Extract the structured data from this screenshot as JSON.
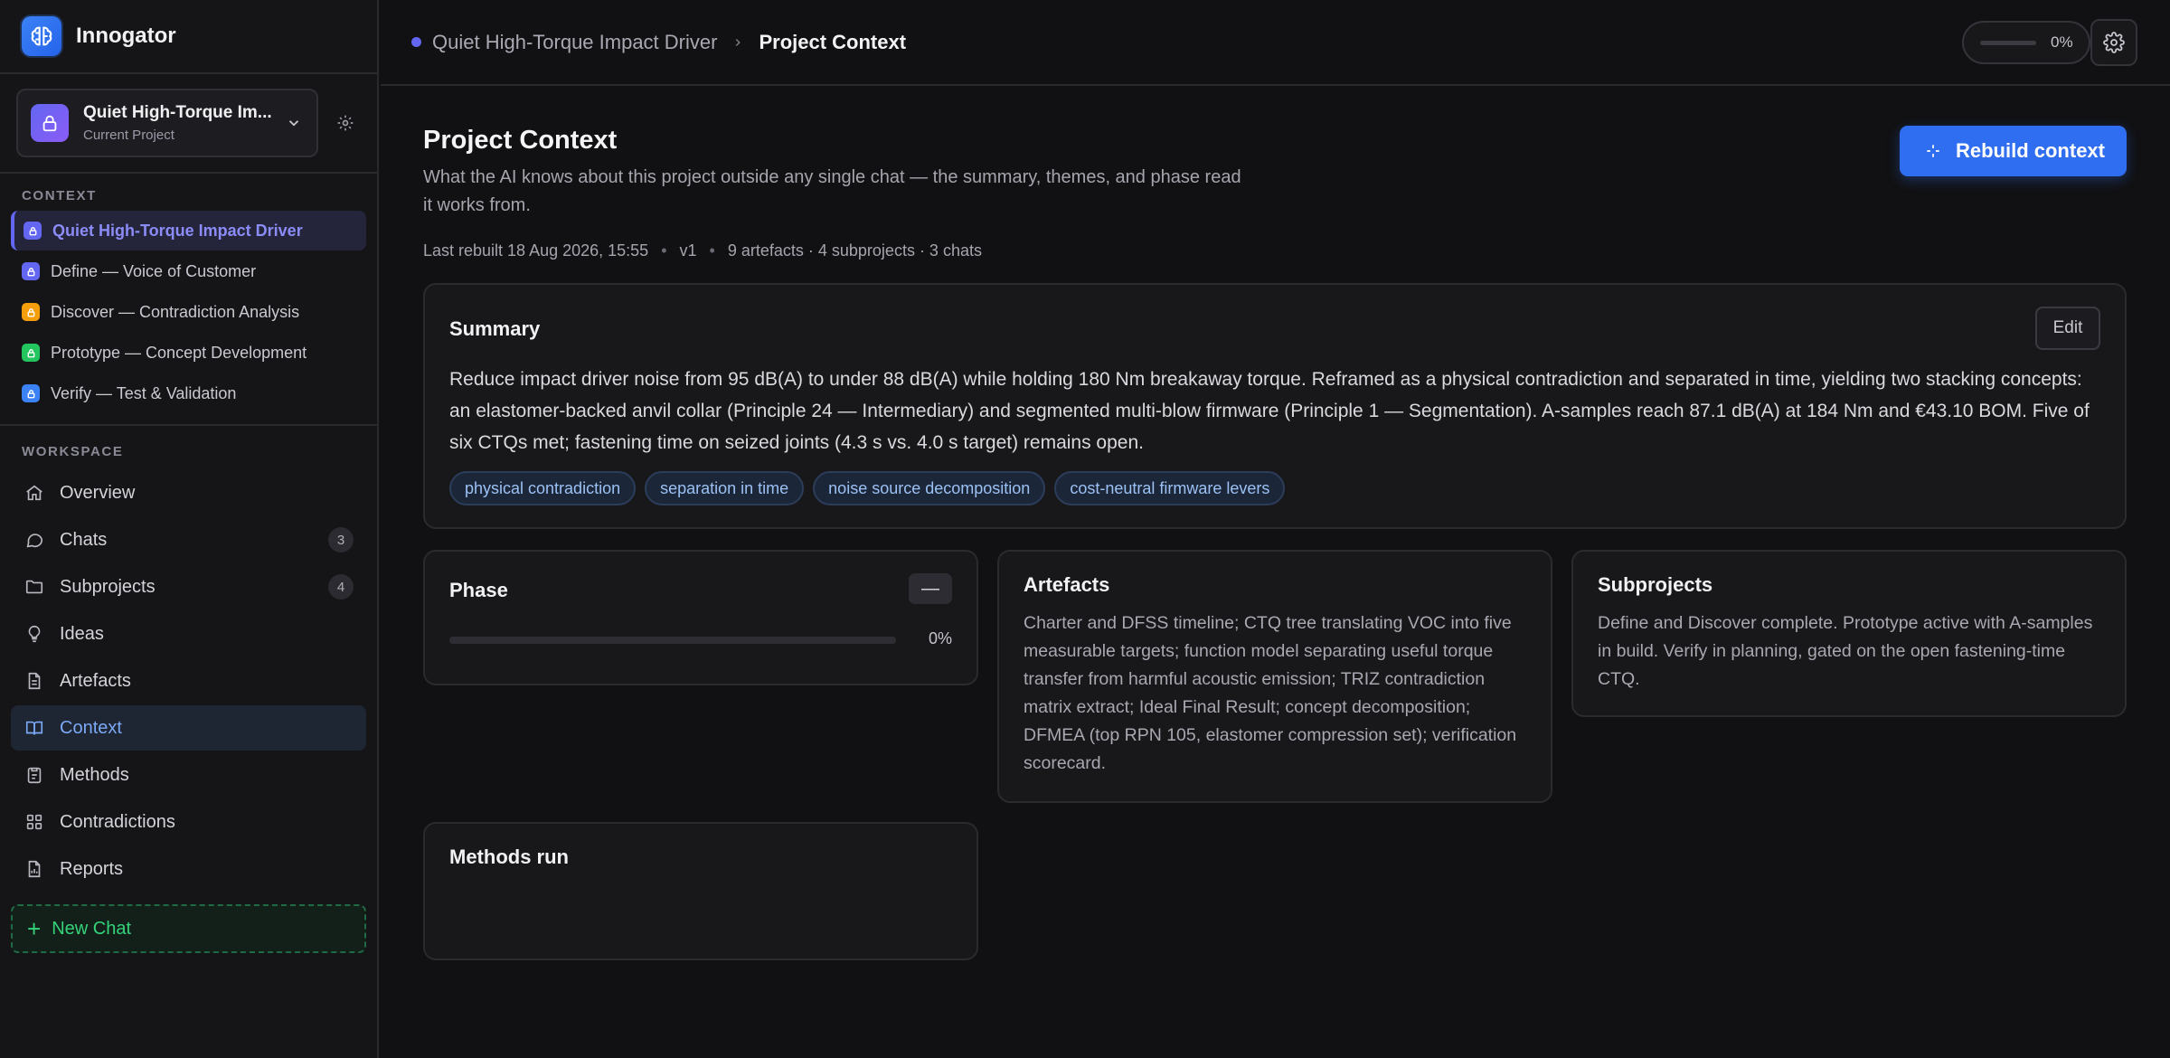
{
  "brand": {
    "name": "Innogator"
  },
  "project_switcher": {
    "name": "Quiet High-Torque Im...",
    "subtitle": "Current Project"
  },
  "sidebar": {
    "context_label": "CONTEXT",
    "context_items": [
      {
        "label": "Quiet High-Torque Impact Driver",
        "color": "#6366f1",
        "active": true
      },
      {
        "label": "Define — Voice of Customer",
        "color": "#6366f1"
      },
      {
        "label": "Discover — Contradiction Analysis",
        "color": "#f59e0b"
      },
      {
        "label": "Prototype — Concept Development",
        "color": "#22c55e"
      },
      {
        "label": "Verify — Test & Validation",
        "color": "#3b82f6"
      }
    ],
    "workspace_label": "WORKSPACE",
    "nav": [
      {
        "label": "Overview",
        "icon": "home-icon"
      },
      {
        "label": "Chats",
        "icon": "chat-icon",
        "badge": "3"
      },
      {
        "label": "Subprojects",
        "icon": "folder-icon",
        "badge": "4"
      },
      {
        "label": "Ideas",
        "icon": "lightbulb-icon"
      },
      {
        "label": "Artefacts",
        "icon": "document-icon"
      },
      {
        "label": "Context",
        "icon": "book-icon",
        "active": true
      },
      {
        "label": "Methods",
        "icon": "clipboard-icon"
      },
      {
        "label": "Contradictions",
        "icon": "grid-icon"
      },
      {
        "label": "Reports",
        "icon": "report-icon"
      }
    ],
    "new_chat_label": "New Chat"
  },
  "topbar": {
    "breadcrumb_parent": "Quiet High-Torque Impact Driver",
    "breadcrumb_current": "Project Context",
    "progress_value": 0,
    "progress_label": "0%"
  },
  "page": {
    "title": "Project Context",
    "description": "What the AI knows about this project outside any single chat — the summary, themes, and phase read it works from.",
    "meta": {
      "rebuilt": "Last rebuilt 18 Aug 2026, 15:55",
      "version": "v1",
      "counts": "9 artefacts · 4 subprojects · 3 chats"
    },
    "rebuild_label": "Rebuild context"
  },
  "summary": {
    "title": "Summary",
    "edit_label": "Edit",
    "text": "Reduce impact driver noise from 95 dB(A) to under 88 dB(A) while holding 180 Nm breakaway torque. Reframed as a physical contradiction and separated in time, yielding two stacking concepts: an elastomer-backed anvil collar (Principle 24 — Intermediary) and segmented multi-blow firmware (Principle 1 — Segmentation). A-samples reach 87.1 dB(A) at 184 Nm and €43.10 BOM. Five of six CTQs met; fastening time on seized joints (4.3 s vs. 4.0 s target) remains open.",
    "tags": [
      "physical contradiction",
      "separation in time",
      "noise source decomposition",
      "cost-neutral firmware levers"
    ]
  },
  "phase": {
    "title": "Phase",
    "badge": "—",
    "progress_value": 0,
    "progress_label": "0%"
  },
  "artefacts": {
    "title": "Artefacts",
    "body": "Charter and DFSS timeline; CTQ tree translating VOC into five measurable targets; function model separating useful torque transfer from harmful acoustic emission; TRIZ contradiction matrix extract; Ideal Final Result; concept decomposition; DFMEA (top RPN 105, elastomer compression set); verification scorecard."
  },
  "subprojects": {
    "title": "Subprojects",
    "body": "Define and Discover complete. Prototype active with A-samples in build. Verify in planning, gated on the open fastening-time CTQ."
  },
  "methods": {
    "title": "Methods run"
  },
  "colors": {
    "accent": "#3b82f6",
    "active_context": "#6366f1",
    "new_chat": "#34d37a"
  }
}
